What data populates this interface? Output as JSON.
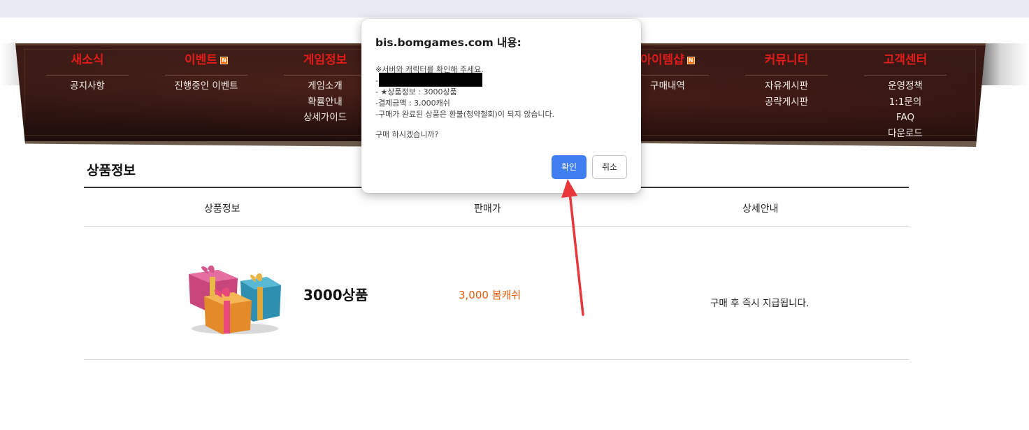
{
  "nav": {
    "columns": [
      {
        "title": "새소식",
        "new": false,
        "items": [
          "공지사항"
        ]
      },
      {
        "title": "이벤트",
        "new": true,
        "items": [
          "진행중인 이벤트"
        ]
      },
      {
        "title": "게임정보",
        "new": false,
        "items": [
          "게임소개",
          "확률안내",
          "상세가이드"
        ]
      },
      {
        "title": "아이템샵",
        "new": true,
        "items": [
          "구매내역"
        ]
      },
      {
        "title": "커뮤니티",
        "new": false,
        "items": [
          "자유게시판",
          "공략게시판"
        ]
      },
      {
        "title": "고객센터",
        "new": false,
        "items": [
          "운영정책",
          "1:1문의",
          "FAQ",
          "다운로드"
        ]
      }
    ],
    "new_badge": "N"
  },
  "section": {
    "title": "상품정보",
    "headers": [
      "상품정보",
      "판매가",
      "상세안내"
    ]
  },
  "product": {
    "name": "3000상품",
    "price": "3,000 봄캐쉬",
    "description": "구매 후 즉시 지급됩니다."
  },
  "dialog": {
    "title": "bis.bomgames.com 내용:",
    "lines": [
      "※서버와 캐릭터를 확인해 주세요.",
      "-",
      "- ★상품정보 : 3000상품",
      "-결제금액 : 3,000캐쉬",
      "-구매가 완료된 상품은 환불(청약철회)이 되지 않습니다.",
      "구매 하시겠습니까?"
    ],
    "ok_label": "확인",
    "cancel_label": "취소"
  },
  "colors": {
    "nav_title": "#e21b1b",
    "price": "#e85a0c",
    "ok_button": "#3f7ef0",
    "annotation_arrow": "#e8373a"
  }
}
